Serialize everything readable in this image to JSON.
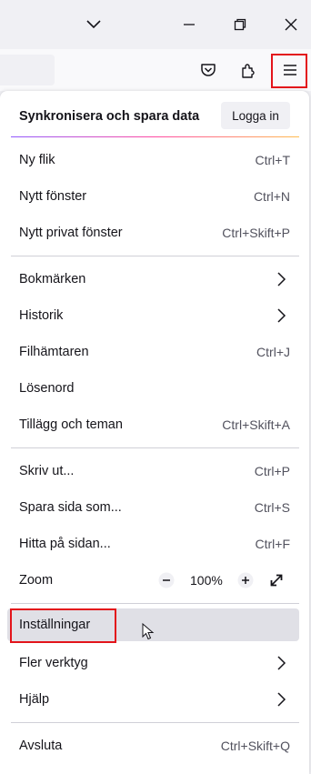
{
  "window": {
    "icons": {
      "tab_list": "chevron-down-icon",
      "minimize": "minimize-icon",
      "restore": "restore-icon",
      "close": "close-icon"
    }
  },
  "toolbar": {
    "icons": [
      "pocket-icon",
      "extensions-icon",
      "hamburger-menu-icon"
    ],
    "highlight_color": "#e3141b"
  },
  "menu": {
    "sync_title": "Synkronisera och spara data",
    "login_label": "Logga in",
    "items": [
      {
        "label": "Ny flik",
        "shortcut": "Ctrl+T"
      },
      {
        "label": "Nytt fönster",
        "shortcut": "Ctrl+N"
      },
      {
        "label": "Nytt privat fönster",
        "shortcut": "Ctrl+Skift+P"
      },
      {
        "label": "Bokmärken",
        "submenu": true
      },
      {
        "label": "Historik",
        "submenu": true
      },
      {
        "label": "Filhämtaren",
        "shortcut": "Ctrl+J"
      },
      {
        "label": "Lösenord"
      },
      {
        "label": "Tillägg och teman",
        "shortcut": "Ctrl+Skift+A"
      },
      {
        "label": "Skriv ut...",
        "shortcut": "Ctrl+P"
      },
      {
        "label": "Spara sida som...",
        "shortcut": "Ctrl+S"
      },
      {
        "label": "Hitta på sidan...",
        "shortcut": "Ctrl+F"
      },
      {
        "label": "Zoom",
        "zoom_value": "100%"
      },
      {
        "label": "Inställningar",
        "hovered": true
      },
      {
        "label": "Fler verktyg",
        "submenu": true
      },
      {
        "label": "Hjälp",
        "submenu": true
      },
      {
        "label": "Avsluta",
        "shortcut": "Ctrl+Skift+Q"
      }
    ]
  }
}
